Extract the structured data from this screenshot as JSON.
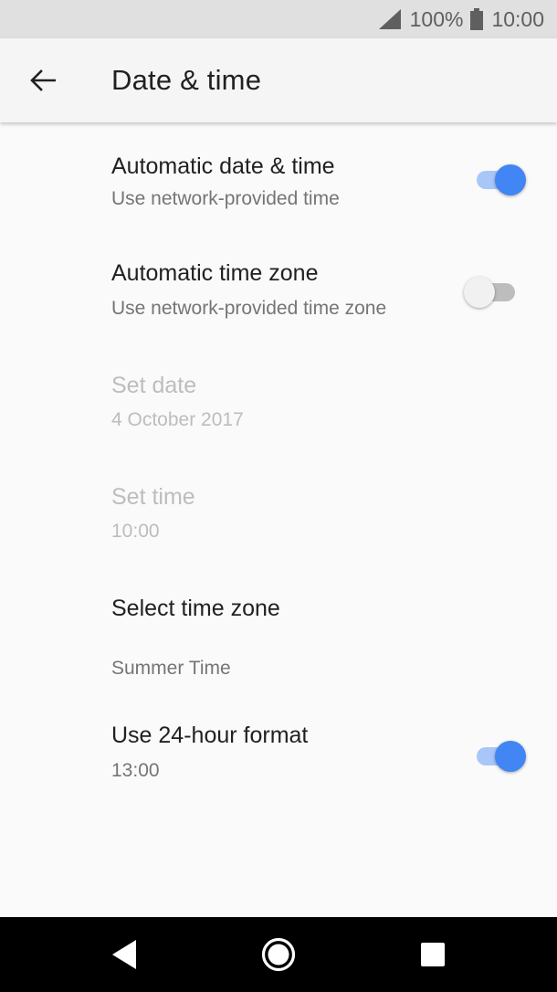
{
  "status_bar": {
    "battery_percent": "100%",
    "time": "10:00",
    "icons": [
      "signal-icon",
      "battery-icon"
    ]
  },
  "app_bar": {
    "title": "Date & time",
    "back_icon": "arrow-back-icon"
  },
  "settings": {
    "auto_date_time": {
      "title": "Automatic date & time",
      "summary": "Use network-provided time",
      "enabled": true
    },
    "auto_time_zone": {
      "title": "Automatic time zone",
      "summary": "Use network-provided time zone",
      "enabled": false
    },
    "set_date": {
      "title": "Set date",
      "summary": "4 October 2017",
      "disabled": true
    },
    "set_time": {
      "title": "Set time",
      "summary": "10:00",
      "disabled": true
    },
    "select_time_zone": {
      "title": "Select time zone",
      "summary": "Summer Time"
    },
    "use_24_hour": {
      "title": "Use 24-hour format",
      "summary": "13:00",
      "enabled": true
    }
  },
  "colors": {
    "accent": "#4285f4",
    "accent_track": "#a8c6f8",
    "background": "#fafafa",
    "status_bar": "#e0e0e0",
    "nav_bar": "#000000"
  },
  "nav_bar": {
    "icons": [
      "back-triangle-icon",
      "home-circle-icon",
      "recents-square-icon"
    ]
  }
}
